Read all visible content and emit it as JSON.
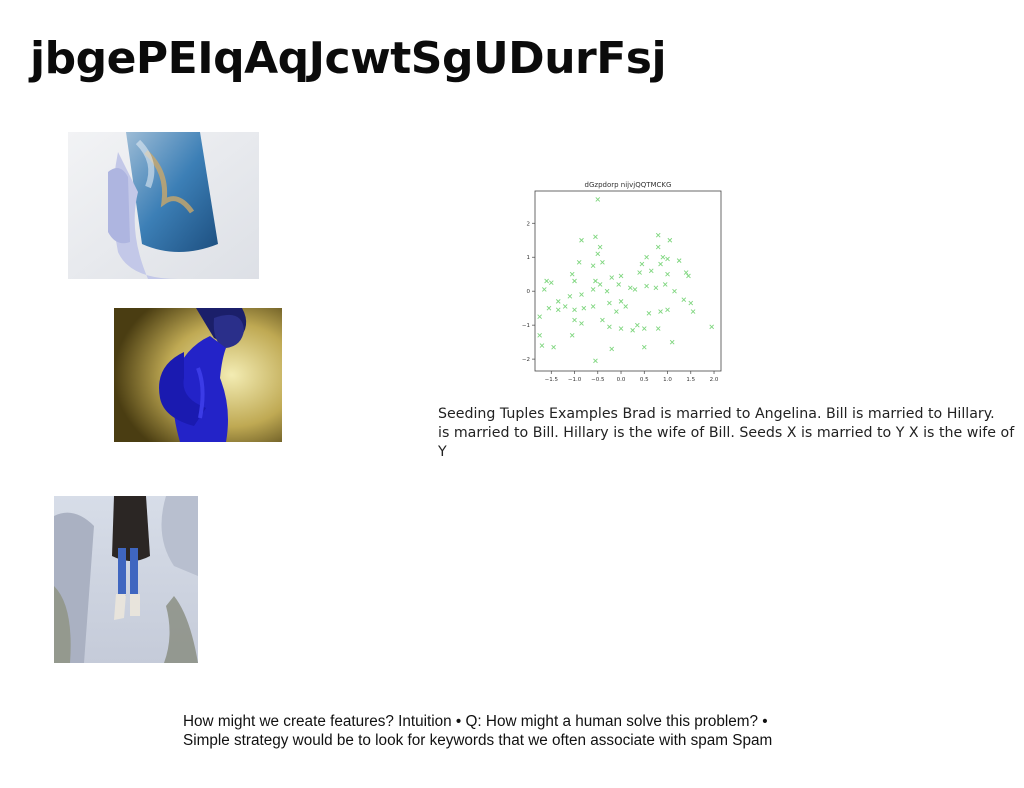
{
  "slide": {
    "title": "jbgePEIqAqJcwtSgUDurFsj",
    "caption": "Seeding Tuples Examples Brad is married to Angelina. Bill is married to Hillary.\nis married to Bill. Hillary is the wife of Bill. Seeds X is married to Y X is the wife of Y",
    "bottom_text": "How might we create features? Intuition • Q: How might a human solve this problem? •\nSimple strategy would be to look for keywords that we often associate with spam Spam"
  },
  "chart_data": {
    "type": "scatter",
    "title": "dGzpdorp nijvjQQTMCKG",
    "xlabel": "",
    "ylabel": "",
    "xlim": [
      -1.85,
      2.15
    ],
    "ylim": [
      -2.35,
      2.95
    ],
    "xticks": [
      -1.5,
      -1.0,
      -0.5,
      0.0,
      0.5,
      1.0,
      1.5,
      2.0
    ],
    "xtick_labels": [
      "−1.5",
      "−1.0",
      "−0.5",
      "0.0",
      "0.5",
      "1.0",
      "1.5",
      "2.0"
    ],
    "yticks": [
      -2,
      -1,
      0,
      1,
      2
    ],
    "ytick_labels": [
      "−2",
      "−1",
      "0",
      "1",
      "2"
    ],
    "marker": "x",
    "color": "#7ed67e",
    "grid": false,
    "points": [
      [
        -0.5,
        2.7
      ],
      [
        -0.85,
        1.5
      ],
      [
        -0.55,
        1.6
      ],
      [
        -0.45,
        1.3
      ],
      [
        0.8,
        1.65
      ],
      [
        1.05,
        1.5
      ],
      [
        0.8,
        1.3
      ],
      [
        -0.5,
        1.1
      ],
      [
        -0.9,
        0.85
      ],
      [
        0.55,
        1.0
      ],
      [
        0.9,
        1.0
      ],
      [
        1.0,
        0.95
      ],
      [
        1.25,
        0.9
      ],
      [
        -0.4,
        0.85
      ],
      [
        -0.6,
        0.75
      ],
      [
        0.45,
        0.8
      ],
      [
        0.85,
        0.8
      ],
      [
        -1.6,
        0.3
      ],
      [
        -1.5,
        0.25
      ],
      [
        -1.65,
        0.05
      ],
      [
        -1.05,
        0.5
      ],
      [
        -1.0,
        0.3
      ],
      [
        -0.55,
        0.3
      ],
      [
        -0.45,
        0.2
      ],
      [
        -0.2,
        0.4
      ],
      [
        0.0,
        0.45
      ],
      [
        0.4,
        0.55
      ],
      [
        0.65,
        0.6
      ],
      [
        1.0,
        0.5
      ],
      [
        1.4,
        0.55
      ],
      [
        1.45,
        0.45
      ],
      [
        -1.35,
        -0.3
      ],
      [
        -1.1,
        -0.15
      ],
      [
        -0.85,
        -0.1
      ],
      [
        -0.6,
        0.05
      ],
      [
        -0.3,
        0.0
      ],
      [
        -0.05,
        0.2
      ],
      [
        0.2,
        0.1
      ],
      [
        0.3,
        0.05
      ],
      [
        0.55,
        0.15
      ],
      [
        0.75,
        0.1
      ],
      [
        0.95,
        0.2
      ],
      [
        1.15,
        0.0
      ],
      [
        1.35,
        -0.25
      ],
      [
        -1.55,
        -0.5
      ],
      [
        -1.35,
        -0.55
      ],
      [
        -1.2,
        -0.45
      ],
      [
        -1.0,
        -0.55
      ],
      [
        -0.8,
        -0.5
      ],
      [
        -0.6,
        -0.45
      ],
      [
        -0.25,
        -0.35
      ],
      [
        0.0,
        -0.3
      ],
      [
        0.1,
        -0.45
      ],
      [
        0.6,
        -0.65
      ],
      [
        0.85,
        -0.6
      ],
      [
        1.0,
        -0.55
      ],
      [
        1.5,
        -0.35
      ],
      [
        -1.75,
        -0.75
      ],
      [
        -1.0,
        -0.85
      ],
      [
        -0.4,
        -0.85
      ],
      [
        -0.25,
        -1.05
      ],
      [
        0.0,
        -1.1
      ],
      [
        0.25,
        -1.15
      ],
      [
        0.5,
        -1.1
      ],
      [
        0.8,
        -1.1
      ],
      [
        1.55,
        -0.6
      ],
      [
        1.95,
        -1.05
      ],
      [
        -1.75,
        -1.3
      ],
      [
        -1.05,
        -1.3
      ],
      [
        -0.85,
        -0.95
      ],
      [
        0.35,
        -1.0
      ],
      [
        1.1,
        -1.5
      ],
      [
        -1.7,
        -1.6
      ],
      [
        -1.45,
        -1.65
      ],
      [
        -0.2,
        -1.7
      ],
      [
        0.5,
        -1.65
      ],
      [
        -0.55,
        -2.05
      ],
      [
        -0.1,
        -0.6
      ]
    ]
  }
}
